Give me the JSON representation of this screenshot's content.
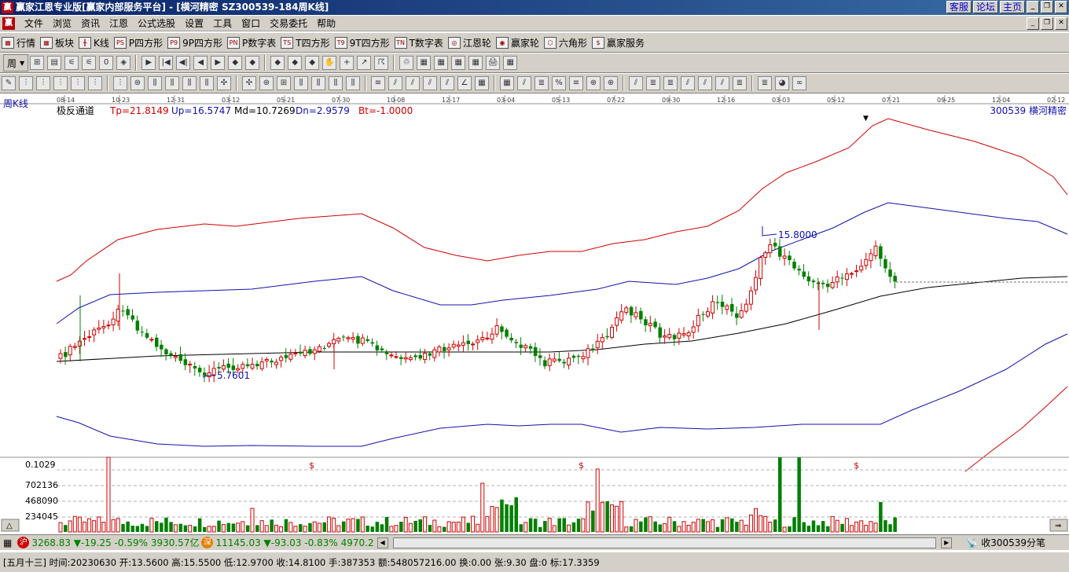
{
  "window": {
    "logo": "赢",
    "title": "赢家江恩专业版[赢家内部服务平台] - [横河精密  SZ300539-184周K线]",
    "links": [
      "客服",
      "论坛",
      "主页"
    ],
    "controls": [
      "_",
      "❐",
      "✕"
    ]
  },
  "menu": {
    "logo": "赢",
    "items": [
      "文件",
      "浏览",
      "资讯",
      "江恩",
      "公式选股",
      "设置",
      "工具",
      "窗口",
      "交易委托",
      "帮助"
    ]
  },
  "toolbar1": {
    "items": [
      {
        "label": "行情",
        "icon": "grid-icon",
        "glyph": "▦"
      },
      {
        "label": "板块",
        "icon": "blocks-icon",
        "glyph": "▦"
      },
      {
        "label": "K线",
        "icon": "candle-icon",
        "glyph": "╫"
      },
      {
        "label": "P四方形",
        "icon": "ps-icon",
        "glyph": "PS"
      },
      {
        "label": "9P四方形",
        "icon": "p9-icon",
        "glyph": "P9"
      },
      {
        "label": "P数字表",
        "icon": "pn-icon",
        "glyph": "PN"
      },
      {
        "label": "T四方形",
        "icon": "ts-icon",
        "glyph": "TS"
      },
      {
        "label": "9T四方形",
        "icon": "t9-icon",
        "glyph": "T9"
      },
      {
        "label": "T数字表",
        "icon": "tn-icon",
        "glyph": "TN"
      },
      {
        "label": "江恩轮",
        "icon": "wheel-icon",
        "glyph": "◎"
      },
      {
        "label": "赢家轮",
        "icon": "winner-wheel-icon",
        "glyph": "◉"
      },
      {
        "label": "六角形",
        "icon": "hexagon-icon",
        "glyph": "⬡"
      },
      {
        "label": "赢家服务",
        "icon": "dollar-icon",
        "glyph": "$"
      }
    ]
  },
  "toolbar2": {
    "period": "周",
    "icons": [
      "⊞",
      "▤",
      "⚟",
      "⚟",
      "0",
      "◈",
      "▶",
      "|◀",
      "◀|",
      "◀",
      "▶",
      "◆",
      "◆",
      "◆",
      "◆",
      "◆",
      "✋",
      "+",
      "↗",
      "☈",
      "♲",
      "▦",
      "▦",
      "▦",
      "▦",
      "🖨",
      "▦"
    ]
  },
  "toolbar3": {
    "icons": [
      "✎",
      "⫶",
      "⫶",
      "⫶",
      "⫶",
      "⫶",
      "⫶",
      "⊛",
      "⫼",
      "⫼",
      "⫼",
      "⫼",
      "✣",
      "✣",
      "⊛",
      "⊞",
      "⫼",
      "⫼",
      "⫼",
      "⫼",
      "≡",
      "⫽",
      "⫽",
      "⫽",
      "⫽",
      "∠",
      "▦",
      "▦",
      "⫽",
      "≣",
      "%",
      "≡",
      "⊕",
      "⊕",
      "⫽",
      "≣",
      "≣",
      "⫽",
      "⫽",
      "⫽",
      "≣",
      "≣",
      "◕",
      "∞"
    ]
  },
  "chart": {
    "period_label": "周K线",
    "indicator": "极反通道",
    "tp": "Tp=21.8149",
    "up": "Up=16.5747",
    "md": "Md=10.7269",
    "dn": "Dn=2.9579",
    "bt": "Bt=-1.0000",
    "stock": "300539 横河精密",
    "high_label": "15.8000",
    "low_label": "5.7601",
    "dates": [
      "08-14",
      "10-23",
      "12-31",
      "03-12",
      "05-21",
      "07-30",
      "10-08",
      "12-17",
      "03-04",
      "05-13",
      "07-22",
      "09-30",
      "12-16",
      "03-03",
      "05-12",
      "07-21",
      "09-25",
      "12-04",
      "02-12"
    ],
    "volume_axis": [
      "0.1029",
      "702136",
      "468090",
      "234045"
    ],
    "dollar_marks": [
      "$",
      "$",
      "$"
    ],
    "colors": {
      "up": "#d00000",
      "down": "#008000",
      "upper": "#d00000",
      "middle": "#1010b0",
      "base": "#000000"
    }
  },
  "chart_data": {
    "type": "candlestick",
    "title": "横河精密 SZ300539 周K线",
    "indicator_values": {
      "Tp": 21.8149,
      "Up": 16.5747,
      "Md": 10.7269,
      "Dn": 2.9579,
      "Bt": -1.0
    },
    "marked_high": 15.8,
    "marked_low": 5.7601,
    "last_close": 14.81
  },
  "status": {
    "sh_badge": "沪",
    "sh_index": "3268.83",
    "sh_change": "▼-19.25",
    "sh_pct": "-0.59%",
    "sh_amount": "3930.57亿",
    "sz_badge": "深",
    "sz_index": "11145.03",
    "sz_change": "▼-93.03",
    "sz_pct": "-0.83%",
    "sz_amount": "4970.2",
    "feed": "收300539分笔"
  },
  "info": {
    "text": "[五月十三] 时间:20230630  开:13.5600  高:15.5500  低:12.9700  收:14.8100  手:387353  额:548057216.00  换:0.00  张:9.30  盘:0  标:17.3359"
  }
}
